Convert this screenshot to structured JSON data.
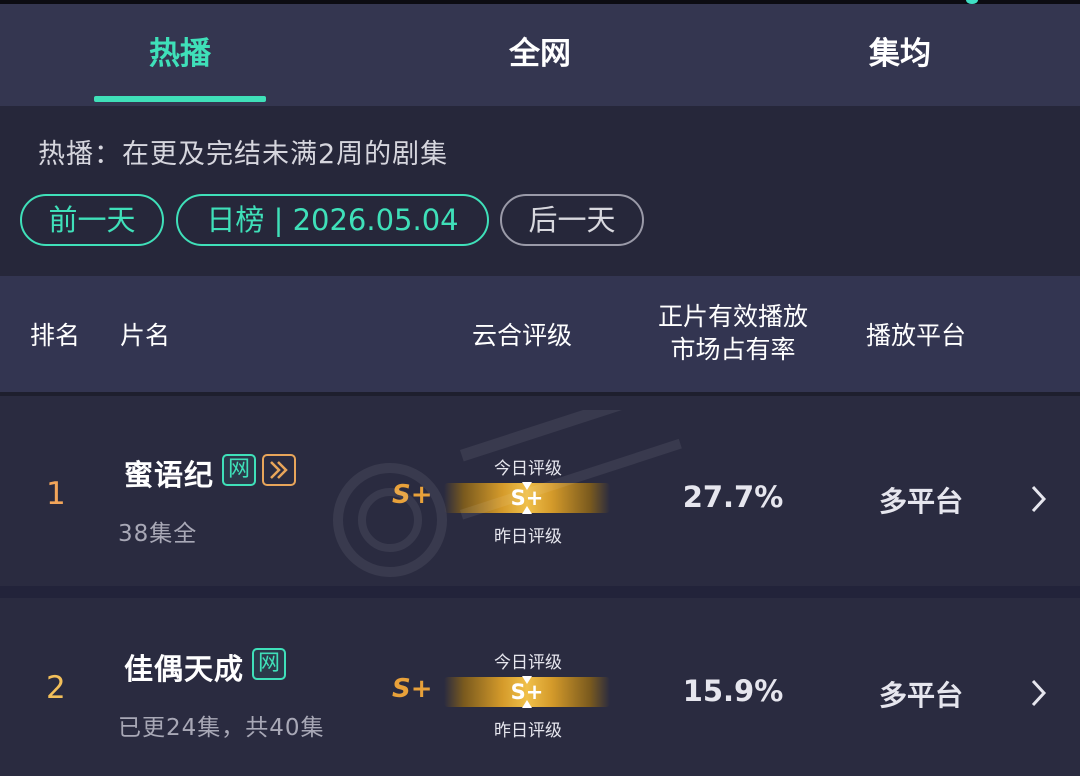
{
  "tabs": [
    {
      "label": "热播",
      "active": true
    },
    {
      "label": "全网",
      "active": false
    },
    {
      "label": "集均",
      "active": false
    }
  ],
  "description": "热播：在更及完结未满2周的剧集",
  "date_nav": {
    "prev_label": "前一天",
    "current_label": "日榜 | 2026.05.04",
    "next_label": "后一天"
  },
  "table_header": {
    "rank": "排名",
    "title": "片名",
    "grade": "云合评级",
    "share_line1": "正片有效播放",
    "share_line2": "市场占有率",
    "platform": "播放平台"
  },
  "rows": [
    {
      "rank": "1",
      "title": "蜜语纪",
      "badge_net": "网",
      "badge_vip_icon": "double-play-icon",
      "episodes": "38集全",
      "grade": "S+",
      "today_grade_label": "今日评级",
      "bar_grade": "S+",
      "yesterday_grade_label": "昨日评级",
      "share": "27.7%",
      "platform": "多平台"
    },
    {
      "rank": "2",
      "title": "佳偶天成",
      "badge_net": "网",
      "episodes": "已更24集，共40集",
      "grade": "S+",
      "today_grade_label": "今日评级",
      "bar_grade": "S+",
      "yesterday_grade_label": "昨日评级",
      "share": "15.9%",
      "platform": "多平台"
    }
  ],
  "colors": {
    "accent": "#3fe0b9",
    "rank1": "#f2a55a",
    "rank2": "#f2bf5a",
    "grade": "#e8a13a",
    "background": "#27283a"
  }
}
